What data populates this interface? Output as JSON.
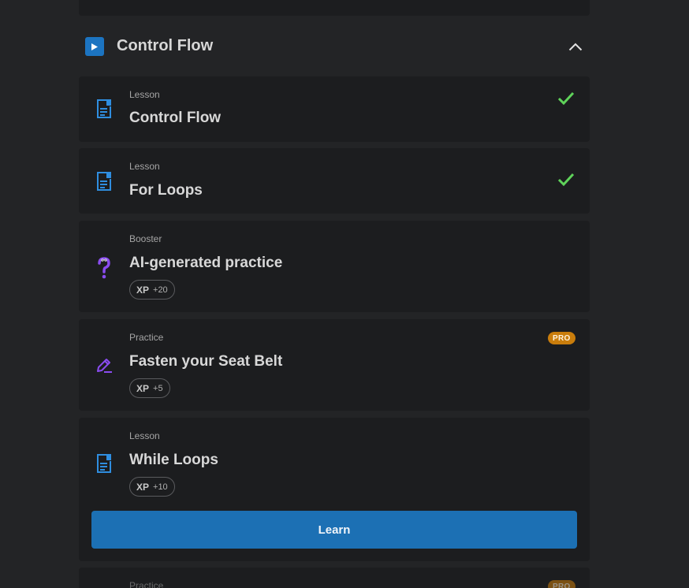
{
  "section": {
    "title": "Control Flow",
    "icon": "play-icon",
    "collapse_icon": "chevron-up-icon",
    "accent_color": "#1c74c1"
  },
  "items": [
    {
      "kind": "Lesson",
      "title": "Control Flow",
      "icon": "lesson-document-icon",
      "completed": true
    },
    {
      "kind": "Lesson",
      "title": "For Loops",
      "icon": "lesson-document-icon",
      "completed": true
    },
    {
      "kind": "Booster",
      "title": "AI-generated practice",
      "icon": "question-mark-icon",
      "xp_label": "XP",
      "xp_value": "+20"
    },
    {
      "kind": "Practice",
      "title": "Fasten your Seat Belt",
      "icon": "pencil-icon",
      "xp_label": "XP",
      "xp_value": "+5",
      "badge": "PRO"
    },
    {
      "kind": "Lesson",
      "title": "While Loops",
      "icon": "lesson-document-icon",
      "xp_label": "XP",
      "xp_value": "+10",
      "action_label": "Learn"
    },
    {
      "kind": "Practice",
      "badge": "PRO"
    }
  ],
  "colors": {
    "background": "#232426",
    "card": "#1c1d1f",
    "check": "#5fd35a",
    "pro_badge": "#c97d0c",
    "primary_button": "#1c70b4",
    "lesson_icon": "#2f8ee0",
    "booster_icon": "#8a4cf0"
  }
}
